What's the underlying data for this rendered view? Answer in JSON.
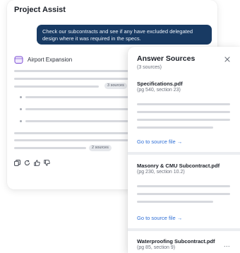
{
  "chat": {
    "title": "Project Assist",
    "user_message": "Check our subcontracts and see if any have excluded delegated design where it was required in the specs.",
    "project_name": "Airport Expansion",
    "pills": [
      "3 sources",
      "2 sources"
    ],
    "actions": [
      "copy-icon",
      "refresh-icon",
      "thumbs-up-icon",
      "thumbs-down-icon"
    ]
  },
  "sources_panel": {
    "title": "Answer Sources",
    "count_label": "(3 sources)",
    "close_icon": "close-icon",
    "sources": [
      {
        "name": "Specifications.pdf",
        "meta": "(pg 540, section 23)",
        "link": "Go to source file  →"
      },
      {
        "name": "Masonry & CMU Subcontract.pdf",
        "meta": "(pg 230, section 10.2)",
        "link": "Go to source file  →"
      },
      {
        "name": "Waterproofing Subcontract.pdf",
        "meta": "(pg 85, section 9)",
        "more": "..."
      }
    ]
  },
  "colors": {
    "bubble": "#183a63",
    "link": "#2f6fd6",
    "project_icon": "#7c4dd6"
  }
}
